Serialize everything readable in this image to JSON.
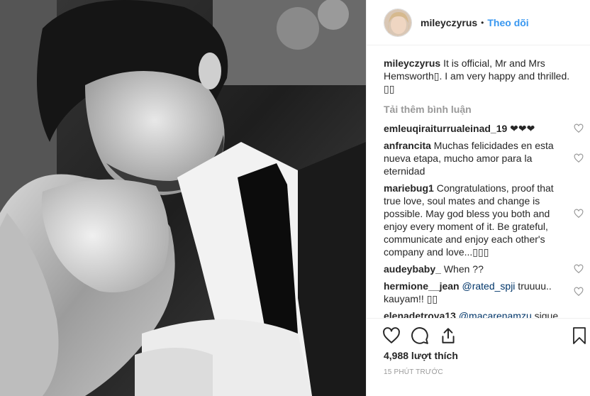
{
  "post": {
    "username": "mileyczyrus",
    "separator": "•",
    "follow_label": "Theo dõi",
    "caption_user": "mileyczyrus",
    "caption_text": "It is official, Mr and Mrs Hemsworth▯. I am very happy and thrilled. ▯▯",
    "load_more": "Tải thêm bình luận",
    "likes": "4,988 lượt thích",
    "time": "15 PHÚT TRƯỚC"
  },
  "comments": [
    {
      "user": "emleuqiraiturrualeinad_19",
      "text": " ❤❤❤",
      "mention": ""
    },
    {
      "user": "anfrancita",
      "text": " Muchas felicidades en esta nueva etapa, mucho amor para la eternidad",
      "mention": ""
    },
    {
      "user": "mariebug1",
      "text": " Congratulations, proof that true love, soul mates and change is possible. May god bless you both and enjoy every moment of it. Be grateful, communicate and enjoy each other's company and love...▯▯▯",
      "mention": ""
    },
    {
      "user": "audeybaby_",
      "text": " When ??",
      "mention": ""
    },
    {
      "user": "hermione__jean",
      "mention": " @rated_spji",
      "text": " truuuu.. kauyam!! ▯▯"
    },
    {
      "user": "elenadetroya13",
      "mention": " @macarenamzu",
      "text": " sigue"
    }
  ],
  "colors": {
    "link": "#3897f0",
    "mention": "#003569",
    "muted": "#999999",
    "text": "#262626",
    "border": "#efefef"
  },
  "icons": [
    "heart-icon",
    "comment-icon",
    "share-icon",
    "bookmark-icon"
  ]
}
